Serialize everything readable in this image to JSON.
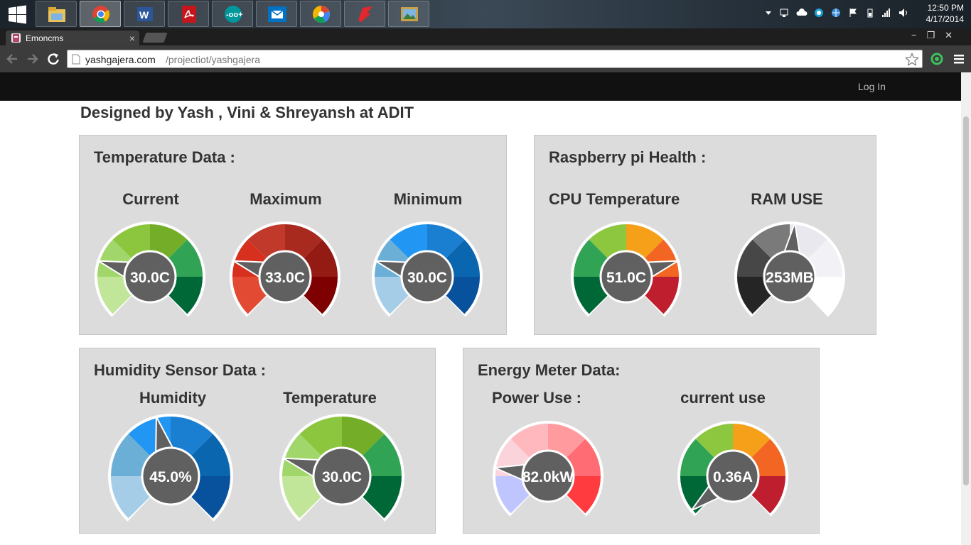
{
  "taskbar": {
    "clock_time": "12:50 PM",
    "clock_date": "4/17/2014",
    "apps": [
      "start-icon",
      "file-explorer-icon",
      "chrome-icon",
      "word-icon",
      "acrobat-icon",
      "arduino-icon",
      "mail-icon",
      "picasa-icon",
      "antivirus-icon",
      "photos-icon"
    ]
  },
  "browser": {
    "tab_title": "Emoncms",
    "tab_close": "×",
    "url_domain": "yashgajera.com",
    "url_path": "/projectiot/yashgajera",
    "window_controls": [
      "−",
      "❐",
      "✕"
    ]
  },
  "nav": {
    "login": "Log In"
  },
  "page": {
    "heading": "Designed by Yash , Vini & Shreyansh at ADIT",
    "temperature_panel": {
      "title": "Temperature Data :",
      "current_label": "Current",
      "current_value": "30.0C",
      "max_label": "Maximum",
      "max_value": "33.0C",
      "min_label": "Minimum",
      "min_value": "30.0C"
    },
    "pi_panel": {
      "title": "Raspberry pi Health :",
      "cpu_label": "CPU Temperature",
      "cpu_value": "51.0C",
      "ram_label": "RAM USE",
      "ram_value": "253MB"
    },
    "humidity_panel": {
      "title": "Humidity Sensor Data :",
      "humidity_label": "Humidity",
      "humidity_value": "45.0%",
      "temp_label": "Temperature",
      "temp_value": "30.0C"
    },
    "energy_panel": {
      "title": "Energy Meter Data:",
      "power_label": "Power Use :",
      "power_value": "82.0kW",
      "current_label": "current use",
      "current_value": "0.36A"
    }
  },
  "gauges": {
    "temp_current": {
      "colors": [
        "#c2e699",
        "#a1d76a",
        "#8cc63f",
        "#74ad27",
        "#31a354",
        "#006837"
      ],
      "needle_fraction": 0.23
    },
    "temp_max": {
      "colors": [
        "#e34a33",
        "#d7301f",
        "#c0392b",
        "#a82a1e",
        "#931b14",
        "#7f0000"
      ],
      "needle_fraction": 0.23
    },
    "temp_min": {
      "colors": [
        "#a6cde8",
        "#6baed6",
        "#2196f3",
        "#1a7fd1",
        "#0b66b0",
        "#08519c"
      ],
      "needle_fraction": 0.23
    },
    "cpu": {
      "colors": [
        "#006837",
        "#31a354",
        "#8dc63f",
        "#f6a01a",
        "#f26522",
        "#be1e2d"
      ],
      "needle_fraction": 0.77
    },
    "ram": {
      "colors": [
        "#252525",
        "#474747",
        "#7a7a7a",
        "#e8e8ee",
        "#f2f2f6",
        "#ffffff"
      ],
      "needle_fraction": 0.52
    },
    "humidity": {
      "colors": [
        "#a6cde8",
        "#6baed6",
        "#2196f3",
        "#1a7fd1",
        "#0b66b0",
        "#08519c"
      ],
      "needle_fraction": 0.45
    },
    "hum_temp": {
      "colors": [
        "#c2e699",
        "#a1d76a",
        "#8cc63f",
        "#74ad27",
        "#31a354",
        "#006837"
      ],
      "needle_fraction": 0.23
    },
    "power": {
      "colors": [
        "#bfc6ff",
        "#fbd3da",
        "#ffb8bd",
        "#ff9a9e",
        "#ff6c73",
        "#ff3b40"
      ],
      "needle_fraction": 0.2
    },
    "current": {
      "colors": [
        "#006837",
        "#31a354",
        "#8dc63f",
        "#f6a01a",
        "#f26522",
        "#be1e2d"
      ],
      "needle_fraction": 0.02
    }
  }
}
